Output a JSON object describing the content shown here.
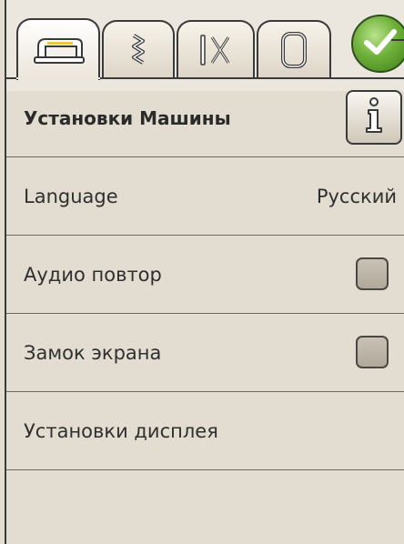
{
  "tabs": [
    {
      "name": "sewing-machine-icon",
      "active": true
    },
    {
      "name": "zigzag-stitch-icon",
      "active": false
    },
    {
      "name": "scissors-icon",
      "active": false
    },
    {
      "name": "hoop-icon",
      "active": false
    }
  ],
  "ok_button": {
    "icon": "checkmark-icon",
    "color": "#6fb03a"
  },
  "title": "Установки Машины",
  "info_button": {
    "icon": "info-icon"
  },
  "settings": {
    "language_label": "Language",
    "language_value": "Русский",
    "audio_label": "Аудио повтор",
    "audio_checked": false,
    "lock_label": "Замок экрана",
    "lock_checked": false,
    "display_label": "Установки дисплея"
  }
}
